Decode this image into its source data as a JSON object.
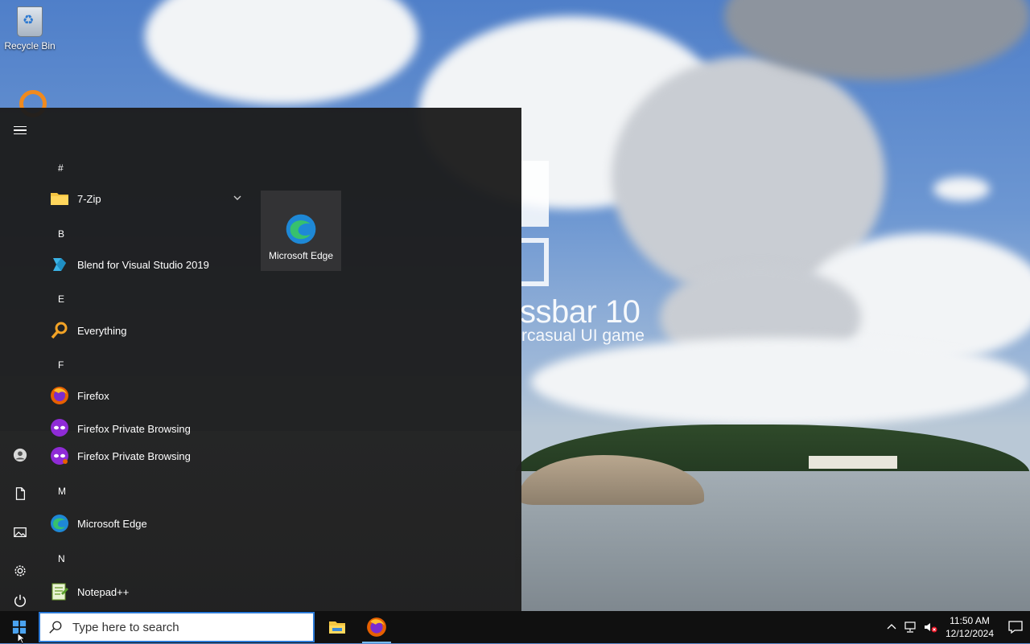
{
  "desktop": {
    "icons": [
      {
        "label": "Recycle Bin",
        "icon": "recycle-bin-icon"
      }
    ],
    "wallpaper": {
      "title": "ssbar 10",
      "subtitle": "rcasual UI game"
    }
  },
  "start_menu": {
    "rail": [
      {
        "name": "expand",
        "icon": "hamburger-icon"
      },
      {
        "name": "account",
        "icon": "user-icon"
      },
      {
        "name": "documents",
        "icon": "document-icon"
      },
      {
        "name": "pictures",
        "icon": "pictures-icon"
      },
      {
        "name": "settings",
        "icon": "gear-icon"
      },
      {
        "name": "power",
        "icon": "power-icon"
      }
    ],
    "groups": [
      {
        "letter": "#",
        "apps": [
          {
            "label": "7-Zip",
            "icon": "folder-icon",
            "expandable": true
          }
        ]
      },
      {
        "letter": "B",
        "apps": [
          {
            "label": "Blend for Visual Studio 2019",
            "icon": "blend-icon"
          }
        ]
      },
      {
        "letter": "E",
        "apps": [
          {
            "label": "Everything",
            "icon": "magnifier-icon"
          }
        ]
      },
      {
        "letter": "F",
        "apps": [
          {
            "label": "Firefox",
            "icon": "firefox-icon"
          },
          {
            "label": "Firefox Private Browsing",
            "icon": "firefox-private-icon"
          },
          {
            "label": "Firefox Private Browsing",
            "icon": "firefox-private-icon"
          }
        ]
      },
      {
        "letter": "M",
        "apps": [
          {
            "label": "Microsoft Edge",
            "icon": "edge-icon"
          }
        ]
      },
      {
        "letter": "N",
        "apps": [
          {
            "label": "Notepad++",
            "icon": "notepadpp-icon"
          }
        ]
      }
    ],
    "tiles": [
      {
        "label": "Microsoft Edge",
        "icon": "edge-icon"
      }
    ]
  },
  "taskbar": {
    "start_icon": "windows-logo-icon",
    "search": {
      "placeholder": "Type here to search",
      "value": ""
    },
    "pinned": [
      {
        "label": "File Explorer",
        "icon": "file-explorer-icon",
        "active": false
      },
      {
        "label": "Firefox",
        "icon": "firefox-icon",
        "active": true
      }
    ],
    "tray": {
      "icons": [
        "chevron-up-icon",
        "network-icon",
        "volume-muted-icon"
      ],
      "time": "11:50 AM",
      "date": "12/12/2024",
      "notification_icon": "action-center-icon"
    }
  },
  "colors": {
    "accent": "#2b79d6",
    "menu_bg": "#1c1c1c",
    "taskbar_bg": "#101010",
    "tile_bg": "#333335"
  }
}
